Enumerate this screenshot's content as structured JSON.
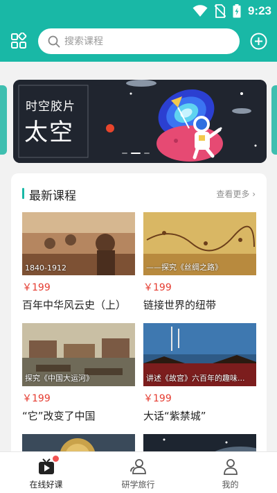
{
  "status_bar": {
    "time": "9:23"
  },
  "search": {
    "placeholder": "搜索课程"
  },
  "banner": {
    "title_small": "时空胶片",
    "title_big": "太空"
  },
  "section": {
    "title": "最新课程",
    "more": "查看更多"
  },
  "courses": [
    {
      "caption": "1840-1912",
      "price": "￥199",
      "name": "百年中华风云史（上）"
    },
    {
      "caption": "——探究《丝绸之路》",
      "price": "￥199",
      "name": "链接世界的纽带"
    },
    {
      "caption": "探究《中国大运河》",
      "price": "￥199",
      "name": "“它”改变了中国"
    },
    {
      "caption": "讲述《故宫》六百年的趣味...",
      "price": "￥199",
      "name": "大话“紫禁城”"
    }
  ],
  "nav": [
    {
      "label": "在线好课",
      "icon": "tv-play-icon",
      "active": true
    },
    {
      "label": "研学旅行",
      "icon": "group-icon",
      "active": false
    },
    {
      "label": "我的",
      "icon": "user-icon",
      "active": false
    }
  ],
  "colors": {
    "primary": "#19b8a6",
    "price": "#e53b30",
    "badge": "#f15252"
  }
}
